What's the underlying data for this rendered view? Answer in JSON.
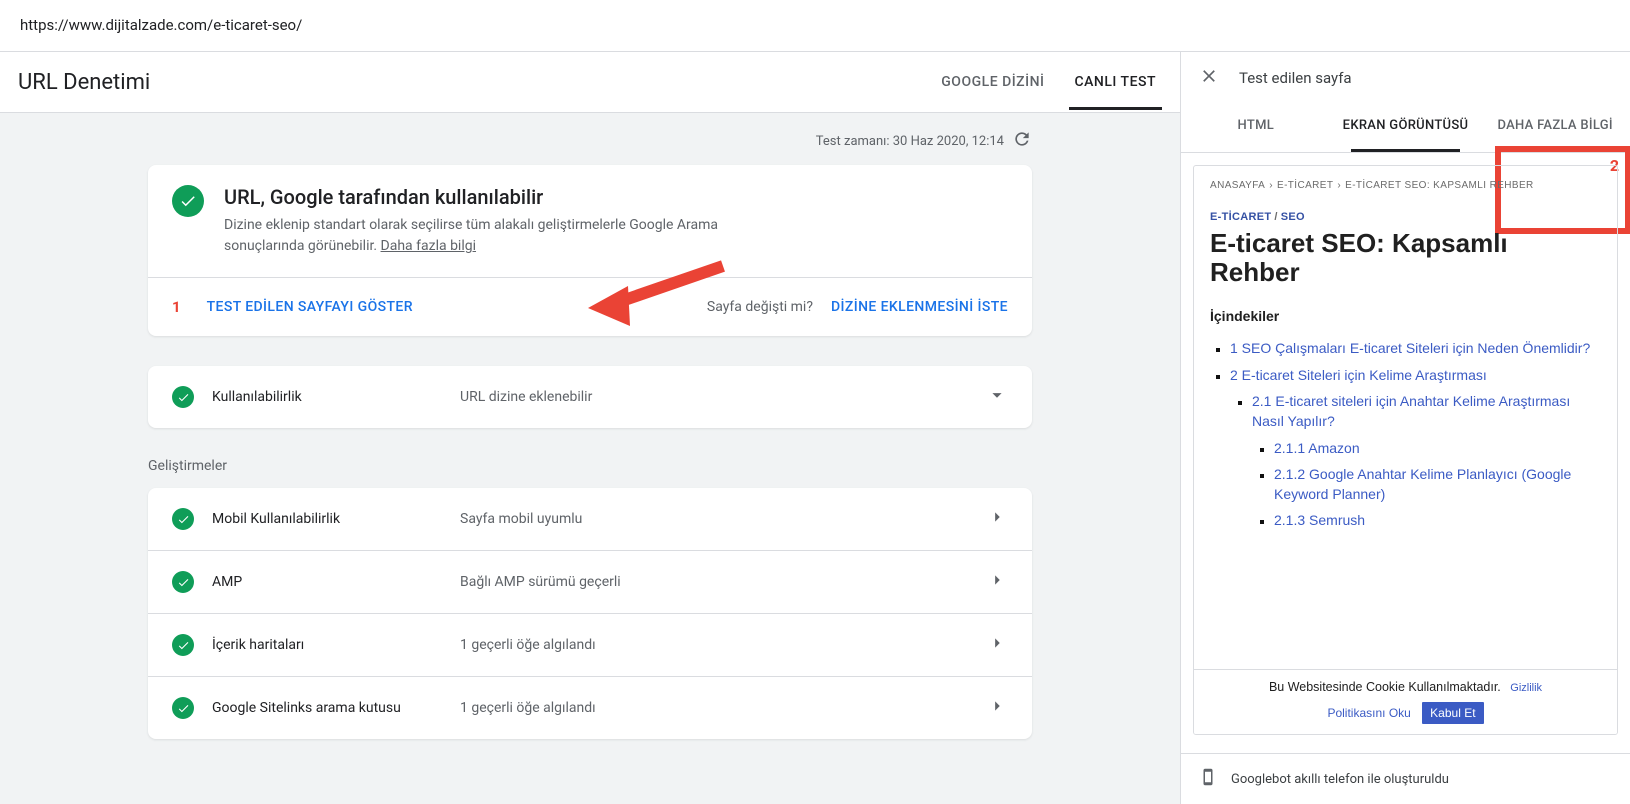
{
  "url": "https://www.dijitalzade.com/e-ticaret-seo/",
  "pageTitle": "URL Denetimi",
  "tabs": {
    "google": "GOOGLE DİZİNİ",
    "live": "CANLI TEST"
  },
  "timestamp": "Test zamanı: 30 Haz 2020, 12:14",
  "mainCard": {
    "title": "URL, Google tarafından kullanılabilir",
    "desc1": "Dizine eklenip standart olarak seçilirse tüm alakalı geliştirmelerle Google Arama sonuçlarında görünebilir. ",
    "more": "Daha fazla bilgi",
    "ann1": "1",
    "viewBtn": "TEST EDİLEN SAYFAYI GÖSTER",
    "changed": "Sayfa değişti mi?",
    "reqIndex": "DİZİNE EKLENMESİNİ İSTE"
  },
  "availability": {
    "label": "Kullanılabilirlik",
    "value": "URL dizine eklenebilir"
  },
  "enhLabel": "Geliştirmeler",
  "enhancements": [
    {
      "label": "Mobil Kullanılabilirlik",
      "value": "Sayfa mobil uyumlu"
    },
    {
      "label": "AMP",
      "value": "Bağlı AMP sürümü geçerli"
    },
    {
      "label": "İçerik haritaları",
      "value": "1 geçerli öğe algılandı"
    },
    {
      "label": "Google Sitelinks arama kutusu",
      "value": "1 geçerli öğe algılandı"
    }
  ],
  "panel": {
    "title": "Test edilen sayfa",
    "tabs": {
      "html": "HTML",
      "screenshot": "EKRAN GÖRÜNTÜSÜ",
      "more": "DAHA FAZLA BİLGİ"
    },
    "ann2": "2"
  },
  "preview": {
    "crumbs": {
      "home": "ANASAYFA",
      "c1": "E-TİCARET",
      "c2": "E-TİCARET SEO: KAPSAMLI REHBER"
    },
    "cat1": "E-TİCARET",
    "cat2": "SEO",
    "heading": "E-ticaret SEO: Kapsamlı Rehber",
    "tocTitle": "İçindekiler",
    "toc": {
      "i1": "1 SEO Çalışmaları E-ticaret Siteleri için Neden Önemlidir?",
      "i2": "2 E-ticaret Siteleri için Kelime Araştırması",
      "i21": "2.1 E-ticaret siteleri için Anahtar Kelime Araştırması Nasıl Yapılır?",
      "i211": "2.1.1 Amazon",
      "i212": "2.1.2 Google Anahtar Kelime Planlayıcı (Google Keyword Planner)",
      "i213": "2.1.3 Semrush"
    },
    "cookie": {
      "text": "Bu Websitesinde Cookie Kullanılmaktadır.",
      "privacy": "Gizlilik",
      "read": "Politikasını Oku",
      "accept": "Kabul Et"
    }
  },
  "device": "Googlebot akıllı telefon ile oluşturuldu"
}
